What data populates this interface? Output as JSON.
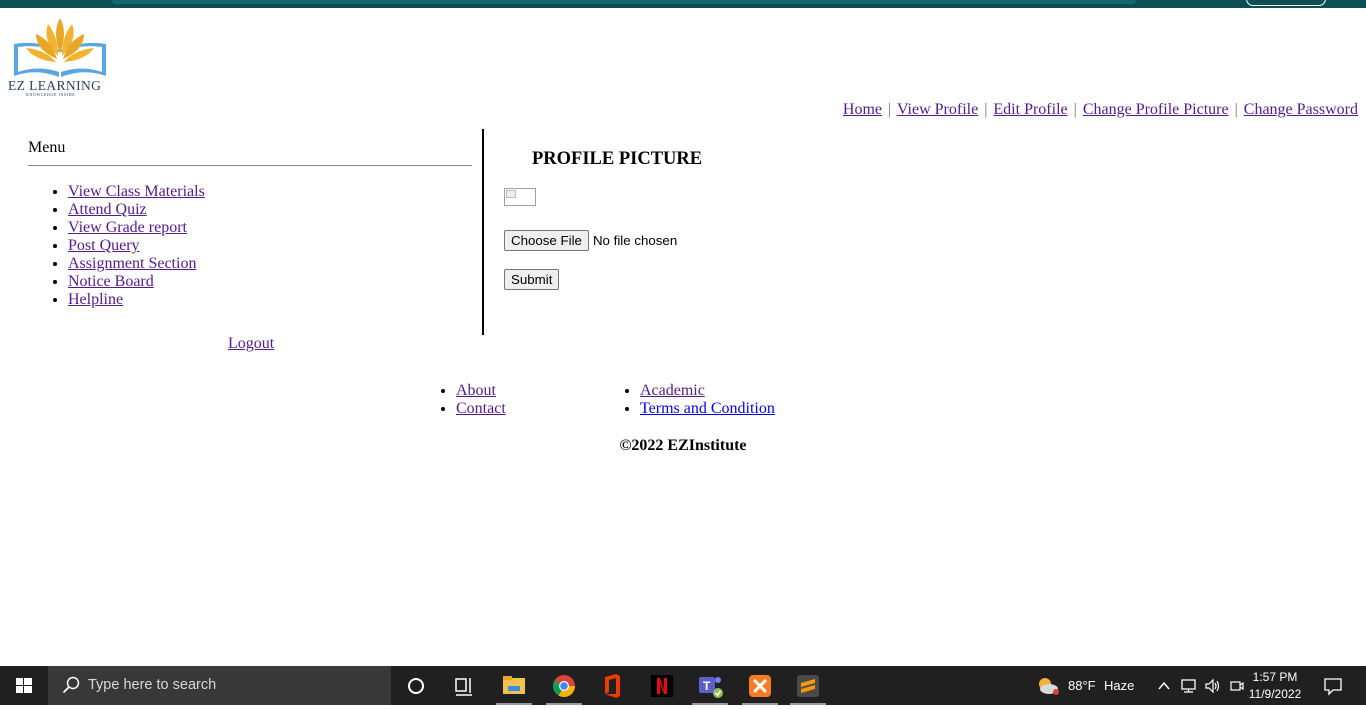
{
  "logo": {
    "text": "EZ LEARNING",
    "tagline": "KNOWLEDGE INSIDE"
  },
  "topnav": {
    "items": [
      "Home",
      "View Profile",
      "Edit Profile",
      "Change Profile Picture",
      "Change Password"
    ],
    "separator": "|"
  },
  "sidebar": {
    "title": "Menu",
    "items": [
      "View Class Materials",
      "Attend Quiz",
      "View Grade report",
      "Post Query",
      "Assignment Section",
      "Notice Board",
      "Helpline"
    ],
    "logout": "Logout"
  },
  "main": {
    "title": "PROFILE PICTURE",
    "choose_file_label": "Choose File",
    "file_status": "No file chosen",
    "submit_label": "Submit"
  },
  "footer": {
    "col1": [
      "About",
      "Contact"
    ],
    "col2": [
      "Academic",
      "Terms and Condition"
    ],
    "copyright": "©2022 EZInstitute"
  },
  "taskbar": {
    "search_placeholder": "Type here to search",
    "weather_temp": "88°F",
    "weather_desc": "Haze",
    "time": "1:57 PM",
    "date": "11/9/2022",
    "apps": [
      "file-explorer-icon",
      "chrome-icon",
      "office-icon",
      "netflix-icon",
      "teams-icon",
      "xampp-icon",
      "sublime-text-icon"
    ]
  },
  "colors": {
    "link": "#0000ee",
    "visited_link": "#551a8b",
    "taskbar_bg": "#202020",
    "top_strip": "#0b4f55"
  }
}
